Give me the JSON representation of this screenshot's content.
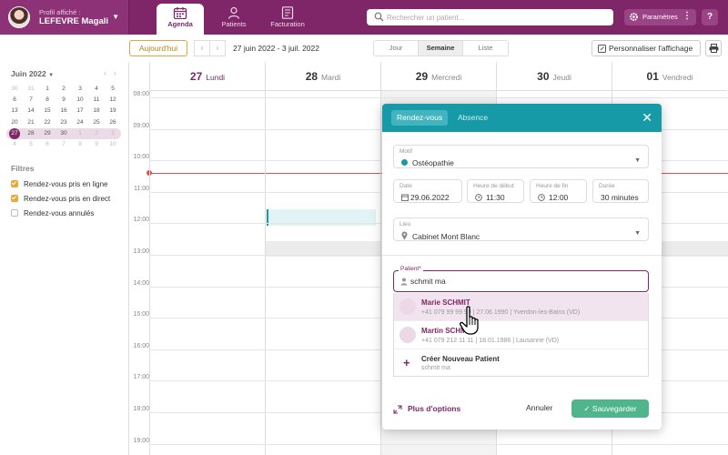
{
  "profile": {
    "label": "Profil affiché :",
    "name": "LEFEVRE Magali"
  },
  "nav": {
    "tabs": [
      {
        "label": "Agenda",
        "icon": "calendar-icon",
        "active": true
      },
      {
        "label": "Patients",
        "icon": "patient-icon",
        "active": false
      },
      {
        "label": "Facturation",
        "icon": "billing-icon",
        "active": false
      }
    ]
  },
  "search": {
    "placeholder": "Rechercher un patient..."
  },
  "settings": {
    "label": "Paramètres"
  },
  "help": {
    "label": "?"
  },
  "toolbar": {
    "today_label": "Aujourd'hui",
    "prev": "‹",
    "next": "›",
    "date_range": "27 juin 2022 - 3 juil. 2022",
    "views": [
      "Jour",
      "Semaine",
      "Liste"
    ],
    "active_view": "Semaine",
    "customize_label": "Personnaliser l'affichage"
  },
  "mini_calendar": {
    "month_label": "Juin 2022",
    "prev": "‹",
    "next": "›",
    "weeks": [
      [
        "30",
        "31",
        "1",
        "2",
        "3",
        "4",
        "5"
      ],
      [
        "6",
        "7",
        "8",
        "9",
        "10",
        "11",
        "12"
      ],
      [
        "13",
        "14",
        "15",
        "16",
        "17",
        "18",
        "19"
      ],
      [
        "20",
        "21",
        "22",
        "23",
        "24",
        "25",
        "26"
      ],
      [
        "27",
        "28",
        "29",
        "30",
        "1",
        "2",
        "3"
      ],
      [
        "4",
        "5",
        "6",
        "7",
        "8",
        "9",
        "10"
      ]
    ],
    "selected_day": "27"
  },
  "filters": {
    "title": "Filtres",
    "items": [
      {
        "label": "Rendez-vous pris en ligne",
        "checked": true
      },
      {
        "label": "Rendez-vous pris en direct",
        "checked": true
      },
      {
        "label": "Rendez-vous annulés",
        "checked": false
      }
    ]
  },
  "calendar": {
    "days": [
      {
        "num": "27",
        "name": "Lundi",
        "today": true
      },
      {
        "num": "28",
        "name": "Mardi",
        "today": false
      },
      {
        "num": "29",
        "name": "Mercredi",
        "today": false
      },
      {
        "num": "30",
        "name": "Jeudi",
        "today": false
      },
      {
        "num": "01",
        "name": "Vendredi",
        "today": false
      }
    ],
    "hours": [
      "08:00",
      "09:00",
      "10:00",
      "11:00",
      "12:00",
      "13:00",
      "14:00",
      "15:00",
      "16:00",
      "17:00",
      "18:00",
      "19:00"
    ]
  },
  "modal": {
    "tabs": [
      "Rendez-vous",
      "Absence"
    ],
    "active_tab": "Rendez-vous",
    "motif": {
      "label": "Motif",
      "value": "Ostéopathie"
    },
    "date": {
      "label": "Date",
      "value": "29.06.2022"
    },
    "start": {
      "label": "Heure de début",
      "value": "11:30"
    },
    "end": {
      "label": "Heure de fin",
      "value": "12:00"
    },
    "duration": {
      "label": "Durée",
      "value": "30 minutes"
    },
    "location": {
      "label": "Lieu",
      "value": "Cabinet Mont Blanc"
    },
    "patient": {
      "label": "Patient*",
      "value": "schmit ma"
    },
    "results": [
      {
        "name": "Marie SCHMIT",
        "info": "+41 079 99 99 99 | 27.06.1990 | Yverdon-les-Bains (VD)"
      },
      {
        "name": "Martin SCHMIT",
        "info": "+41 079 212 11 11 | 18.01.1986 | Lausanne (VD)"
      }
    ],
    "create": {
      "label": "Créer Nouveau Patient",
      "sub": "schmit ma"
    },
    "more_options": "Plus d'options",
    "cancel": "Annuler",
    "save": "Sauvegarder"
  },
  "colors": {
    "brand": "#7e2667",
    "teal": "#179aa7",
    "save": "#4fb58a",
    "now": "#e05050"
  }
}
